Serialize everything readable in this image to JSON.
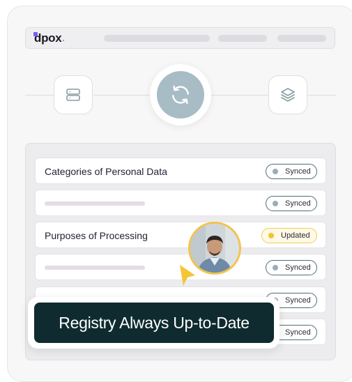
{
  "brand": {
    "logo_text": "dpox",
    "logo_suffix": "."
  },
  "nodes": [
    {
      "icon": "server-icon"
    },
    {
      "icon": "sync-icon"
    },
    {
      "icon": "layers-icon"
    }
  ],
  "rows": [
    {
      "label": "Categories of Personal Data",
      "status": "Synced"
    },
    {
      "label": "",
      "status": "Synced"
    },
    {
      "label": "Purposes of Processing",
      "status": "Updated"
    },
    {
      "label": "",
      "status": "Synced"
    },
    {
      "label": "",
      "status": "Synced"
    },
    {
      "label": "",
      "status": "Synced"
    }
  ],
  "toast": {
    "text": "Registry Always Up-to-Date"
  },
  "colors": {
    "accent": "#7b5cf0",
    "sync_circle": "#a7bcc5",
    "synced_border": "#4d6f78",
    "updated_border": "#f0cc5a",
    "updated_dot": "#f3c237",
    "toast_bg": "#0f2b2f",
    "avatar_ring": "#f3c34c"
  }
}
